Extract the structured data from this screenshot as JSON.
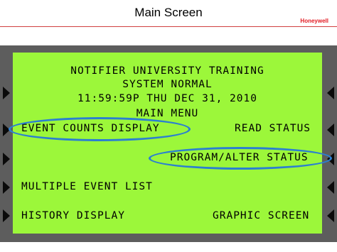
{
  "slide": {
    "title": "Main Screen",
    "logo": "Honeywell"
  },
  "lcd": {
    "header_line1": "NOTIFIER UNIVERSITY TRAINING",
    "header_line2": "SYSTEM NORMAL",
    "datetime": "11:59:59P THU DEC 31, 2010",
    "menu_title": "MAIN MENU",
    "options": {
      "event_counts": "EVENT COUNTS DISPLAY",
      "read_status": "READ STATUS",
      "program_alter": "PROGRAM/ALTER STATUS",
      "multiple_event": "MULTIPLE EVENT LIST",
      "history": "HISTORY DISPLAY",
      "graphic": "GRAPHIC SCREEN"
    }
  },
  "colors": {
    "lcd_background": "#9cf73a",
    "bezel": "#5d5d5d",
    "highlight_ring": "#2b7fd1",
    "logo": "#e31b23"
  },
  "icons": {
    "soft_keys": "triangle-arrow-icon"
  }
}
